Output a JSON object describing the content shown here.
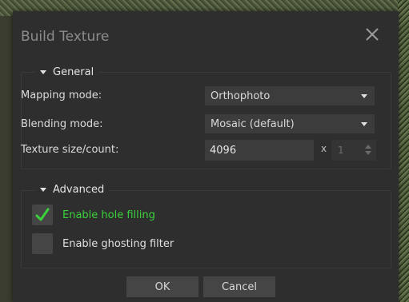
{
  "dialog": {
    "title": "Build Texture",
    "close_icon": "close-icon"
  },
  "general": {
    "heading": "General",
    "mapping_mode": {
      "label": "Mapping mode:",
      "value": "Orthophoto"
    },
    "blending_mode": {
      "label": "Blending mode:",
      "value": "Mosaic (default)"
    },
    "texture_size": {
      "label": "Texture size/count:",
      "size_value": "4096",
      "separator": "x",
      "count_value": "1"
    }
  },
  "advanced": {
    "heading": "Advanced",
    "hole_filling": {
      "label": "Enable hole filling",
      "checked": true
    },
    "ghosting_filter": {
      "label": "Enable ghosting filter",
      "checked": false
    }
  },
  "buttons": {
    "ok": "OK",
    "cancel": "Cancel"
  },
  "colors": {
    "dialog_bg": "#2e2e2e",
    "checked_text": "#3bd13b"
  }
}
